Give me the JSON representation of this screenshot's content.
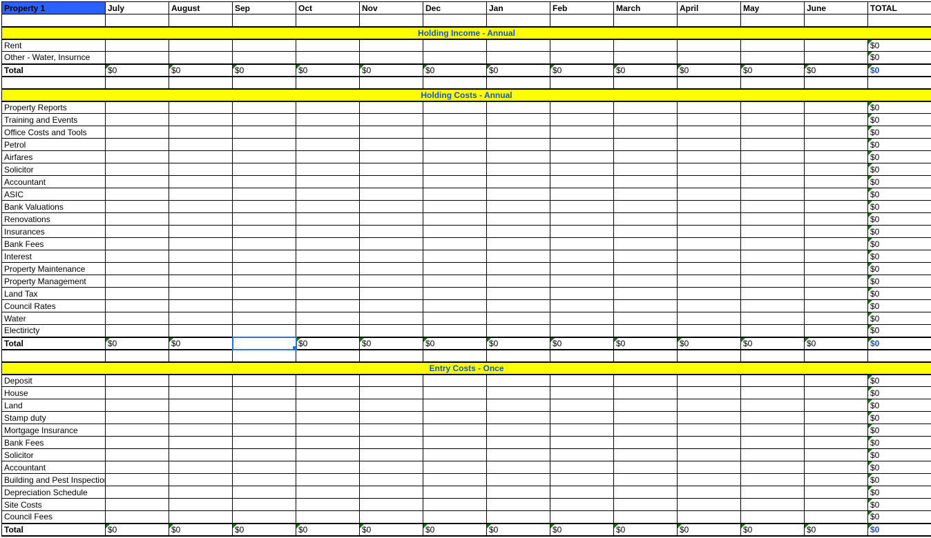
{
  "header": {
    "property": "Property 1",
    "months": [
      "July",
      "August",
      "Sep",
      "Oct",
      "Nov",
      "Dec",
      "Jan",
      "Feb",
      "March",
      "April",
      "May",
      "June"
    ],
    "total": "TOTAL"
  },
  "zero": "$0",
  "sections": [
    {
      "title": "Holding Income - Annual",
      "rows": [
        "Rent",
        "Other - Water, Insurnce"
      ],
      "totalLabel": "Total"
    },
    {
      "title": "Holding Costs - Annual",
      "rows": [
        "Property Reports",
        "Training and Events",
        "Office Costs and Tools",
        "Petrol",
        "Airfares",
        "Solicitor",
        "Accountant",
        "ASIC",
        "Bank Valuations",
        "Renovations",
        "Insurances",
        "Bank Fees",
        "Interest",
        "Property Maintenance",
        "Property Management",
        "Land Tax",
        "Council Rates",
        "Water",
        "Electiricty"
      ],
      "totalLabel": "Total"
    },
    {
      "title": "Entry Costs - Once",
      "rows": [
        "Deposit",
        "House",
        "Land",
        "Stamp duty",
        "Mortgage Insurance",
        "Bank Fees",
        "Solicitor",
        "Accountant",
        "Building and Pest Inspection",
        "Depreciation Schedule",
        "Site Costs",
        "Council Fees"
      ],
      "totalLabel": "Total"
    }
  ],
  "selected": {
    "section": 1,
    "isTotalRow": true,
    "monthIndex": 2
  }
}
